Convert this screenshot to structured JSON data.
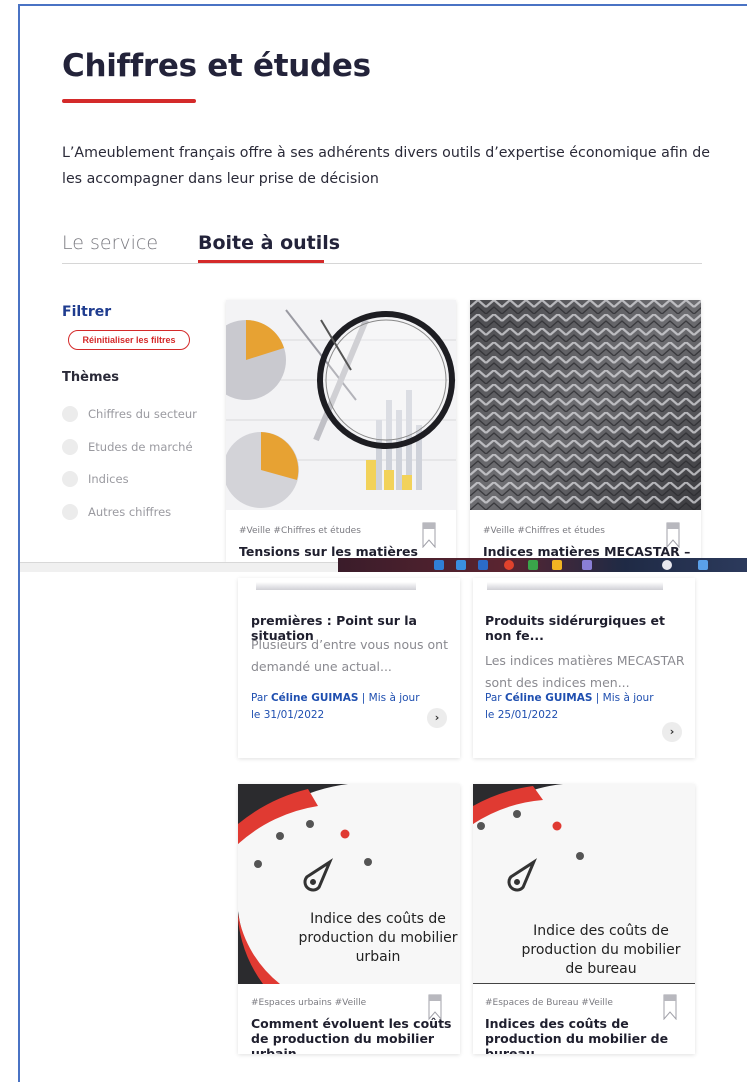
{
  "page": {
    "title": "Chiffres et études",
    "intro": "L’Ameublement français offre à ses adhérents divers outils d’expertise économique afin de les accompagner dans leur prise de décision"
  },
  "tabs": [
    {
      "label": "Le service",
      "active": false
    },
    {
      "label": "Boite à outils",
      "active": true
    }
  ],
  "filters": {
    "title": "Filtrer",
    "reset_label": "Réinitialiser les filtres",
    "themes_title": "Thèmes",
    "themes": [
      "Chiffres du secteur",
      "Etudes de marché",
      "Indices",
      "Autres chiffres"
    ]
  },
  "cards_top": [
    {
      "tags": "#Veille #Chiffres et études",
      "title": "Tensions sur les matières"
    },
    {
      "tags": "#Veille #Chiffres et études",
      "title": "Indices matières MECASTAR –"
    }
  ],
  "cards_mid": [
    {
      "title": "premières : Point sur la situation",
      "excerpt": "Plusieurs d’entre vous nous ont demandé une actual...",
      "author_prefix": "Par",
      "author": "Céline GUIMAS",
      "updated": "| Mis à jour",
      "date": "le 31/01/2022"
    },
    {
      "title": "Produits sidérurgiques et non fe...",
      "excerpt": "Les indices matières MECASTAR sont des indices men...",
      "author_prefix": "Par",
      "author": "Céline GUIMAS",
      "updated": "| Mis à jour",
      "date": "le 25/01/2022"
    }
  ],
  "cards_bottom": [
    {
      "image_text": "Indice des coûts de production du mobilier urbain",
      "tags": "#Espaces urbains #Veille",
      "title": "Comment évoluent les coûts de production du mobilier urbain..."
    },
    {
      "image_text": "Indice des coûts de production du mobilier de bureau",
      "tags": "#Espaces de Bureau #Veille",
      "title": "Indices des coûts de production du mobilier de bureau"
    }
  ],
  "colors": {
    "accent_red": "#d42a2a",
    "brand_blue": "#1f3c8f",
    "frame_blue": "#4a73c4"
  },
  "icons": {
    "bookmark": "bookmark-icon",
    "arrow": "chevron-right-icon"
  },
  "arrow_glyph": "›"
}
